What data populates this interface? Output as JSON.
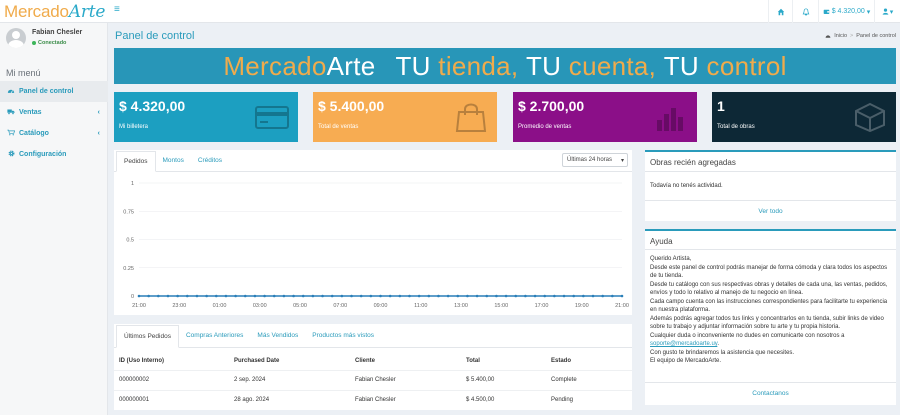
{
  "header": {
    "logo_part1": "Mercado",
    "logo_part2": "Arte",
    "balance": "$ 4.320,00"
  },
  "user": {
    "name": "Fabian Chesler",
    "status": "Conectado"
  },
  "sidebar": {
    "heading": "Mi menú",
    "items": [
      {
        "label": "Panel de control",
        "icon": "gauge-icon"
      },
      {
        "label": "Ventas",
        "icon": "truck-icon"
      },
      {
        "label": "Catálogo",
        "icon": "cart-icon"
      },
      {
        "label": "Configuración",
        "icon": "gear-icon"
      }
    ]
  },
  "page": {
    "title": "Panel de control",
    "breadcrumb_home": "Inicio",
    "breadcrumb_current": "Panel de control"
  },
  "banner": {
    "brand1": "Mercado",
    "brand2": "Arte",
    "w1": "TU",
    "w2": "tienda,",
    "w3": "TU",
    "w4": "cuenta,",
    "w5": "TU",
    "w6": "control"
  },
  "cards": [
    {
      "amount": "$ 4.320,00",
      "label": "Mi billetera",
      "color": "#1c9fc1"
    },
    {
      "amount": "$ 5.400,00",
      "label": "Total de ventas",
      "color": "#f7ac52"
    },
    {
      "amount": "$ 2.700,00",
      "label": "Promedio de ventas",
      "color": "#8b0f88"
    },
    {
      "amount": "1",
      "label": "Total de obras",
      "color": "#0d2836"
    }
  ],
  "chart_tabs": [
    "Pedidos",
    "Montos",
    "Créditos"
  ],
  "range_select": "Últimas 24 horas",
  "chart_data": {
    "type": "line",
    "x": [
      "23:00",
      "00:00",
      "01:00",
      "02:00",
      "03:00",
      "04:00",
      "05:00",
      "06:00",
      "07:00",
      "08:00",
      "09:00",
      "10:00",
      "11:00",
      "12:00",
      "13:00",
      "14:00",
      "15:00",
      "16:00",
      "17:00",
      "18:00",
      "19:00",
      "20:00",
      "21:00"
    ],
    "x_ticks": [
      "21:00",
      "23:00",
      "01:00",
      "03:00",
      "05:00",
      "07:00",
      "09:00",
      "11:00",
      "13:00",
      "15:00",
      "17:00",
      "19:00",
      "21:00"
    ],
    "y_ticks": [
      "1",
      "0.75",
      "0.5",
      "0.25",
      "0"
    ],
    "series": [
      {
        "values": [
          0,
          0,
          0,
          0,
          0,
          0,
          0,
          0,
          0,
          0,
          0,
          0,
          0,
          0,
          0,
          0,
          0,
          0,
          0,
          0,
          0,
          0,
          0,
          0,
          0,
          0,
          0,
          0,
          0,
          0,
          0,
          0,
          0,
          0,
          0,
          0,
          0,
          0,
          0,
          0,
          0,
          0,
          0,
          0,
          0,
          0,
          0,
          0,
          0,
          0,
          0
        ]
      }
    ],
    "ylim": [
      0,
      1
    ],
    "grid": true,
    "color": "#2a7fb8"
  },
  "orders": {
    "tabs": [
      "Últimos Pedidos",
      "Compras Anteriores",
      "Más Vendidos",
      "Productos más vistos"
    ],
    "columns": [
      "ID (Uso Interno)",
      "Purchased Date",
      "Cliente",
      "Total",
      "Estado"
    ],
    "rows": [
      [
        "000000002",
        "2 sep. 2024",
        "Fabian Chesler",
        "$ 5.400,00",
        "Complete"
      ],
      [
        "000000001",
        "28 ago. 2024",
        "Fabian Chesler",
        "$ 4.500,00",
        "Pending"
      ]
    ]
  },
  "obras": {
    "title": "Obras recién agregadas",
    "empty": "Todavía no tenés actividad.",
    "footer": "Ver todo"
  },
  "ayuda": {
    "title": "Ayuda",
    "lines": [
      "Querido Artista,",
      "Desde este panel de control podrás manejar de forma cómoda y clara todos los aspectos de tu tienda.",
      "Desde tu catálogo con sus respectivas obras y detalles de cada una, las ventas, pedidos, envíos y todo lo relativo al manejo de tu negocio en línea.",
      "Cada campo cuenta con las instrucciones correspondientes para facilitarte tu experiencia en nuestra plataforma.",
      "Además podrás agregar todos tus links y concentrarlos en tu tienda, subir links de video sobre tu trabajo y adjuntar información sobre tu arte y tu propia historia.",
      "Cualquier duda o inconveniente no dudes en comunicarte con nosotros a"
    ],
    "email": "soporte@mercadoarte.uy",
    "after_email": ".",
    "closing1": "Con gusto te brindaremos la asistencia que necesites.",
    "closing2": "El equipo de MercadoArte.",
    "footer": "Contactanos"
  }
}
